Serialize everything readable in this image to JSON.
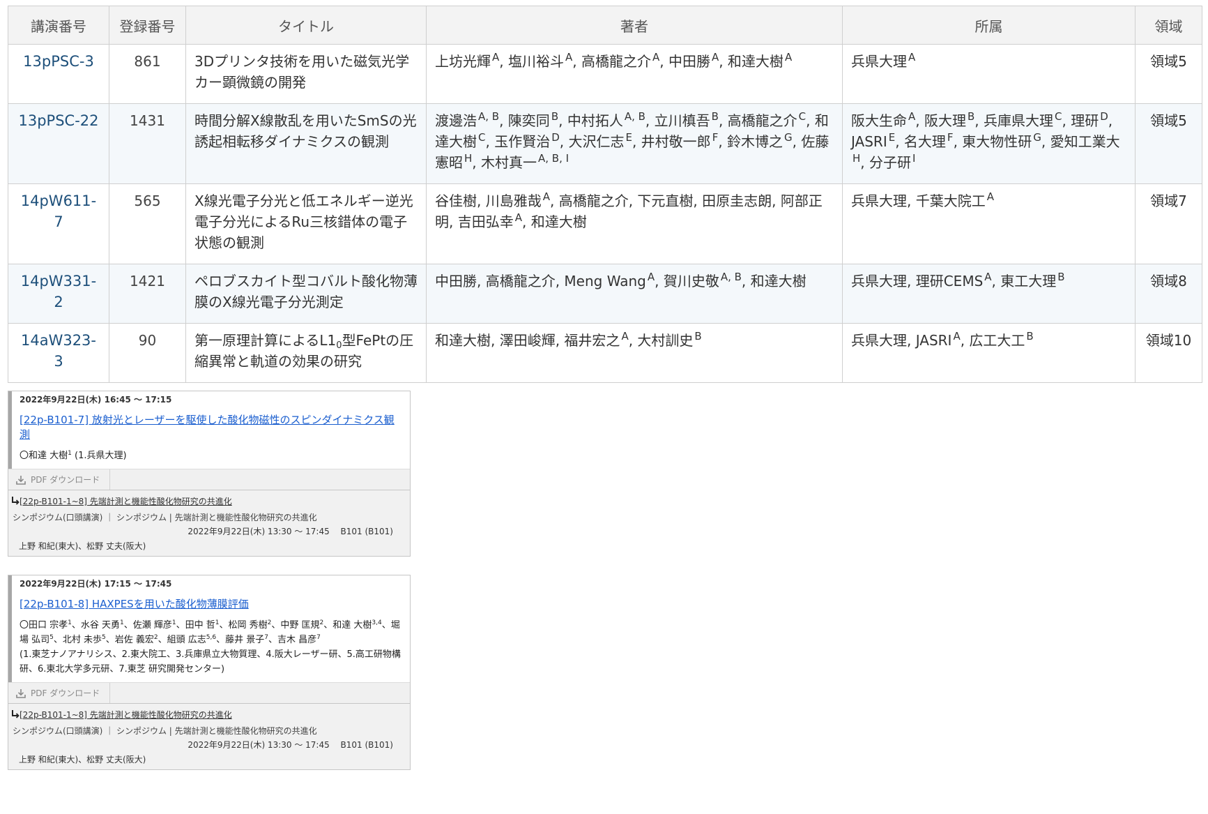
{
  "table": {
    "headers": [
      "講演番号",
      "登録番号",
      "タイトル",
      "著者",
      "所属",
      "領域"
    ],
    "rows": [
      {
        "code": "13pPSC-3",
        "reg": "861",
        "title_html": "3Dプリンタ技術を用いた磁気光学カー顕微鏡の開発",
        "authors_html": "上坊光輝<sup>A</sup>, 塩川裕斗<sup>A</sup>, 高橋龍之介<sup>A</sup>, 中田勝<sup>A</sup>, 和達大樹<sup>A</sup>",
        "affil_html": "兵県大理<sup>A</sup>",
        "area": "領域5"
      },
      {
        "code": "13pPSC-22",
        "reg": "1431",
        "title_html": "時間分解X線散乱を用いたSmSの光誘起相転移ダイナミクスの観測",
        "authors_html": "渡邊浩<sup>A, B</sup>, 陳奕同<sup>B</sup>, 中村拓人<sup>A, B</sup>, 立川槙吾<sup>B</sup>, 高橋龍之介<sup>C</sup>, 和達大樹<sup>C</sup>, 玉作賢治<sup>D</sup>, 大沢仁志<sup>E</sup>, 井村敬一郎<sup>F</sup>, 鈴木博之<sup>G</sup>, 佐藤憲昭<sup>H</sup>, 木村真一<sup>A, B, I</sup>",
        "affil_html": "阪大生命<sup>A</sup>, 阪大理<sup>B</sup>, 兵庫県大理<sup>C</sup>, 理研<sup>D</sup>, JASRI<sup>E</sup>, 名大理<sup>F</sup>, 東大物性研<sup>G</sup>, 愛知工業大<sup>H</sup>, 分子研<sup>I</sup>",
        "area": "領域5"
      },
      {
        "code": "14pW611-7",
        "reg": "565",
        "title_html": "X線光電子分光と低エネルギー逆光電子分光によるRu三核錯体の電子状態の観測",
        "authors_html": "谷佳樹, 川島雅哉<sup>A</sup>, 高橋龍之介, 下元直樹, 田原圭志朗, 阿部正明, 吉田弘幸<sup>A</sup>, 和達大樹",
        "affil_html": "兵県大理, 千葉大院工<sup>A</sup>",
        "area": "領域7"
      },
      {
        "code": "14pW331-2",
        "reg": "1421",
        "title_html": "ペロブスカイト型コバルト酸化物薄膜のX線光電子分光測定",
        "authors_html": "中田勝, 高橋龍之介, Meng Wang<sup>A</sup>, 賀川史敬<sup>A, B</sup>, 和達大樹",
        "affil_html": "兵県大理, 理研CEMS<sup>A</sup>, 東工大理<sup>B</sup>",
        "area": "領域8"
      },
      {
        "code": "14aW323-3",
        "reg": "90",
        "title_html": "第一原理計算によるL1<sub>0</sub>型FePtの圧縮異常と軌道の効果の研究",
        "authors_html": "和達大樹, 澤田峻輝, 福井宏之<sup>A</sup>, 大村訓史<sup>B</sup>",
        "affil_html": "兵県大理, JASRI<sup>A</sup>, 広工大工<sup>B</sup>",
        "area": "領域10"
      }
    ]
  },
  "cards": [
    {
      "time": "2022年9月22日(木) 16:45 〜 17:15",
      "title": "[22p-B101-7] 放射光とレーザーを駆使した酸化物磁性のスピンダイナミクス観測",
      "authors_html": "〇和達 大樹<sup>1</sup> (1.兵県大理)",
      "affil": "",
      "pdf_label": "PDF ダウンロード",
      "session_link": "[22p-B101-1~8] 先端計測と機能性酸化物研究の共進化",
      "session_category": "シンポジウム(口頭講演) ｜ シンポジウム | 先端計測と機能性酸化物研究の共進化",
      "session_time": "2022年9月22日(木) 13:30 〜 17:45　 B101 (B101)",
      "session_chairs": "上野 和紀(東大)、松野 丈夫(阪大)"
    },
    {
      "time": "2022年9月22日(木) 17:15 〜 17:45",
      "title": "[22p-B101-8] HAXPESを用いた酸化物薄膜評価",
      "authors_html": "〇田口 宗孝<sup>1</sup>、水谷 天勇<sup>1</sup>、佐瀬 輝彦<sup>1</sup>、田中 哲<sup>1</sup>、松岡 秀樹<sup>2</sup>、中野 匡規<sup>2</sup>、和達 大樹<sup>3,4</sup>、堀場 弘司<sup>5</sup>、北村 未歩<sup>5</sup>、岩佐 義宏<sup>2</sup>、組頭 広志<sup>5,6</sup>、藤井 景子<sup>7</sup>、吉木 昌彦<sup>7</sup>",
      "affil": "(1.東芝ナノアナリシス、2.東大院工、3.兵庫県立大物質理、4.阪大レーザー研、5.高工研物構研、6.東北大学多元研、7.東芝 研究開発センター)",
      "pdf_label": "PDF ダウンロード",
      "session_link": "[22p-B101-1~8] 先端計測と機能性酸化物研究の共進化",
      "session_category": "シンポジウム(口頭講演) ｜ シンポジウム | 先端計測と機能性酸化物研究の共進化",
      "session_time": "2022年9月22日(木) 13:30 〜 17:45　 B101 (B101)",
      "session_chairs": "上野 和紀(東大)、松野 丈夫(阪大)"
    }
  ]
}
